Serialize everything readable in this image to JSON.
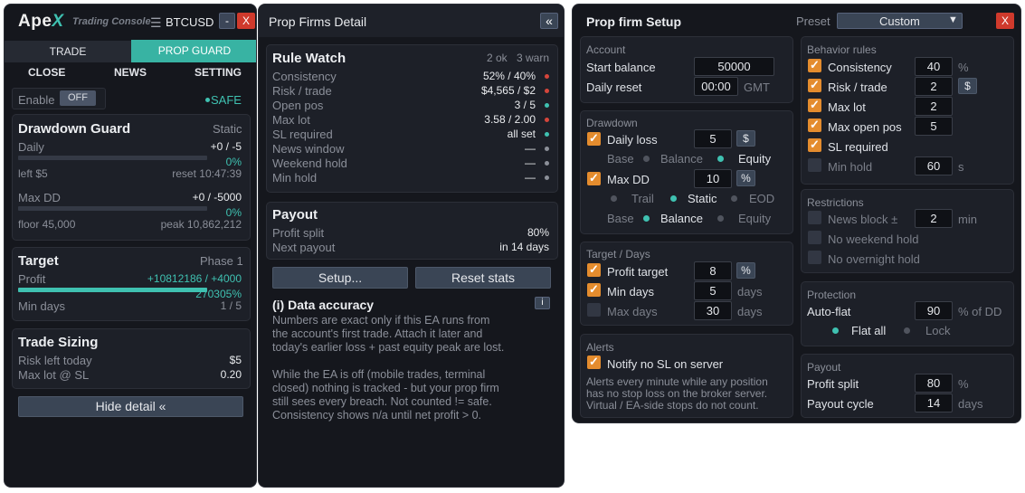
{
  "console": {
    "logo_ape": "Ape",
    "logo_x": "X",
    "subtitle": "Trading Console",
    "menu_icon": "hamburger-icon",
    "symbol": "BTCUSD",
    "minimize": "-",
    "close": "X",
    "tabs": [
      "TRADE",
      "PROP GUARD"
    ],
    "subtabs": [
      "CLOSE",
      "NEWS",
      "SETTING"
    ],
    "enable_label": "Enable",
    "enable_toggle": "OFF",
    "safe": "SAFE",
    "drawdown": {
      "title": "Drawdown Guard",
      "mode": "Static",
      "daily_label": "Daily",
      "daily_value": "+0 / -5",
      "daily_pct": "0%",
      "daily_left": "left $5",
      "daily_reset": "reset 10:47:39",
      "maxdd_label": "Max DD",
      "maxdd_value": "+0 / -5000",
      "maxdd_pct": "0%",
      "floor": "floor 45,000",
      "peak": "peak 10,862,212"
    },
    "target": {
      "title": "Target",
      "phase": "Phase 1",
      "profit_label": "Profit",
      "profit_value": "+10812186 / +4000",
      "profit_pct": "270305%",
      "profit_fill": 1.0,
      "mindays_label": "Min days",
      "mindays_value": "1 / 5"
    },
    "sizing": {
      "title": "Trade Sizing",
      "risk_label": "Risk left today",
      "risk_value": "$5",
      "maxlot_label": "Max lot @ SL",
      "maxlot_value": "0.20"
    },
    "hide_button": "Hide detail «"
  },
  "detail": {
    "title": "Prop Firms Detail",
    "collapse": "«",
    "rulewatch": {
      "title": "Rule Watch",
      "ok": "2 ok",
      "warn": "3 warn",
      "rows": [
        {
          "label": "Consistency",
          "value": "52% / 40%",
          "status": "red"
        },
        {
          "label": "Risk / trade",
          "value": "$4,565 / $2",
          "status": "red"
        },
        {
          "label": "Open pos",
          "value": "3 / 5",
          "status": "teal"
        },
        {
          "label": "Max lot",
          "value": "3.58 / 2.00",
          "status": "red"
        },
        {
          "label": "SL required",
          "value": "all set",
          "status": "teal"
        },
        {
          "label": "News window",
          "value": "—",
          "status": "grey"
        },
        {
          "label": "Weekend hold",
          "value": "—",
          "status": "grey"
        },
        {
          "label": "Min hold",
          "value": "—",
          "status": "grey"
        }
      ]
    },
    "payout": {
      "title": "Payout",
      "split_label": "Profit split",
      "split_value": "80%",
      "next_label": "Next payout",
      "next_value": "in 14 days"
    },
    "setup_button": "Setup...",
    "reset_button": "Reset stats",
    "accuracy": {
      "title": "(i)  Data accuracy",
      "info_btn": "i",
      "lines1": [
        "Numbers are exact only if this EA runs from",
        "the account's first trade. Attach it later and",
        "today's earlier loss + past equity peak are lost."
      ],
      "lines2": [
        "While the EA is off (mobile trades, terminal",
        "closed) nothing is tracked - but your prop firm",
        "still sees every breach. Not counted != safe.",
        "Consistency shows n/a until net profit > 0."
      ]
    }
  },
  "setup": {
    "title": "Prop firm Setup",
    "preset_label": "Preset",
    "preset_value": "Custom",
    "close": "X",
    "account": {
      "title": "Account",
      "start_label": "Start balance",
      "start_value": "50000",
      "reset_label": "Daily reset",
      "reset_value": "00:00",
      "reset_unit": "GMT"
    },
    "drawdown": {
      "title": "Drawdown",
      "daily_label": "Daily loss",
      "daily_value": "5",
      "daily_unit": "$",
      "base_label": "Base",
      "base_opt1": "Balance",
      "base_opt2": "Equity",
      "maxdd_label": "Max DD",
      "maxdd_value": "10",
      "maxdd_unit": "%",
      "trail": "Trail",
      "static": "Static",
      "eod": "EOD",
      "base2_label": "Base",
      "base2_opt1": "Balance",
      "base2_opt2": "Equity"
    },
    "target": {
      "title": "Target / Days",
      "profit_label": "Profit target",
      "profit_value": "8",
      "profit_unit": "%",
      "mindays_label": "Min days",
      "mindays_value": "5",
      "mindays_unit": "days",
      "maxdays_label": "Max days",
      "maxdays_value": "30",
      "maxdays_unit": "days"
    },
    "alerts": {
      "title": "Alerts",
      "notify_label": "Notify no SL on server",
      "desc": [
        "Alerts every minute while any position",
        "has no stop loss on the broker server.",
        "Virtual / EA-side stops do not count."
      ]
    },
    "behavior": {
      "title": "Behavior rules",
      "consistency_label": "Consistency",
      "consistency_value": "40",
      "consistency_unit": "%",
      "risk_label": "Risk / trade",
      "risk_value": "2",
      "risk_unit": "$",
      "maxlot_label": "Max lot",
      "maxlot_value": "2",
      "maxpos_label": "Max open pos",
      "maxpos_value": "5",
      "sl_label": "SL required",
      "minhold_label": "Min hold",
      "minhold_value": "60",
      "minhold_unit": "s"
    },
    "restrictions": {
      "title": "Restrictions",
      "news_label": "News block ±",
      "news_value": "2",
      "news_unit": "min",
      "weekend_label": "No weekend hold",
      "overnight_label": "No overnight hold"
    },
    "protection": {
      "title": "Protection",
      "autoflat_label": "Auto-flat",
      "autoflat_value": "90",
      "autoflat_unit": "% of DD",
      "flat_all": "Flat all",
      "lock": "Lock"
    },
    "payout": {
      "title": "Payout",
      "split_label": "Profit split",
      "split_value": "80",
      "split_unit": "%",
      "cycle_label": "Payout cycle",
      "cycle_value": "14",
      "cycle_unit": "days"
    }
  },
  "colors": {
    "accent_teal": "#3fc1b1",
    "check_orange": "#e48c2e",
    "close_red": "#d03a2c",
    "warn_red": "#d5453b"
  }
}
